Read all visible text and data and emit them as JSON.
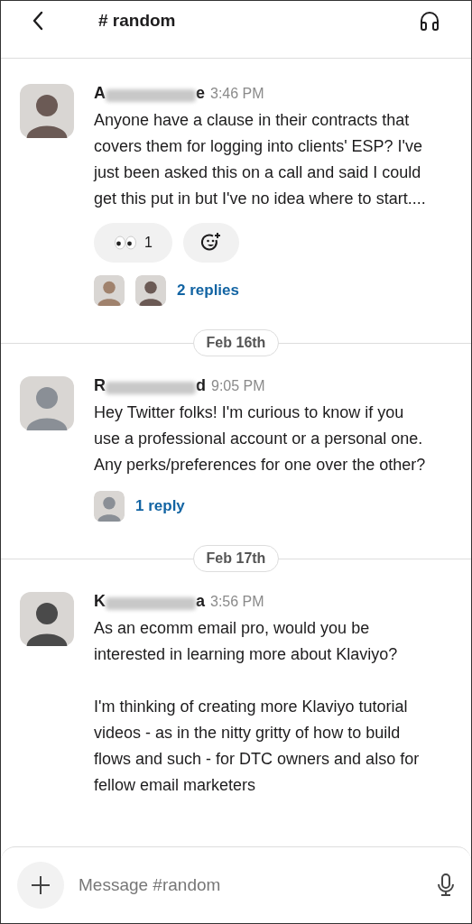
{
  "header": {
    "channel": "# random"
  },
  "feed": [
    {
      "kind": "message",
      "name_start": "A",
      "name_end": "e",
      "time": "3:46 PM",
      "paragraphs": [
        "Anyone have a clause in their contracts that covers them for logging into clients' ESP? I've just been asked this on a call and said I could get this put in but I've no idea where to start...."
      ],
      "reactions": [
        {
          "kind": "emoji",
          "count": "1"
        },
        {
          "kind": "add"
        }
      ],
      "replies": {
        "label": "2 replies"
      }
    },
    {
      "kind": "divider",
      "label": "Feb 16th"
    },
    {
      "kind": "message",
      "name_start": "R",
      "name_end": "d",
      "time": "9:05 PM",
      "paragraphs": [
        "Hey Twitter folks! I'm curious to know if you use a professional account or a personal one. Any perks/preferences for one over the other?"
      ],
      "replies": {
        "label": "1 reply"
      }
    },
    {
      "kind": "divider",
      "label": "Feb 17th"
    },
    {
      "kind": "message",
      "name_start": "K",
      "name_end": "a",
      "time": "3:56 PM",
      "paragraphs": [
        "As an ecomm email pro, would you be interested in learning more about Klaviyo?",
        "I'm thinking of creating more Klaviyo tutorial videos - as in the nitty gritty of how to build flows and such - for DTC owners and also for fellow email marketers"
      ]
    }
  ],
  "composer": {
    "placeholder": "Message #random"
  }
}
